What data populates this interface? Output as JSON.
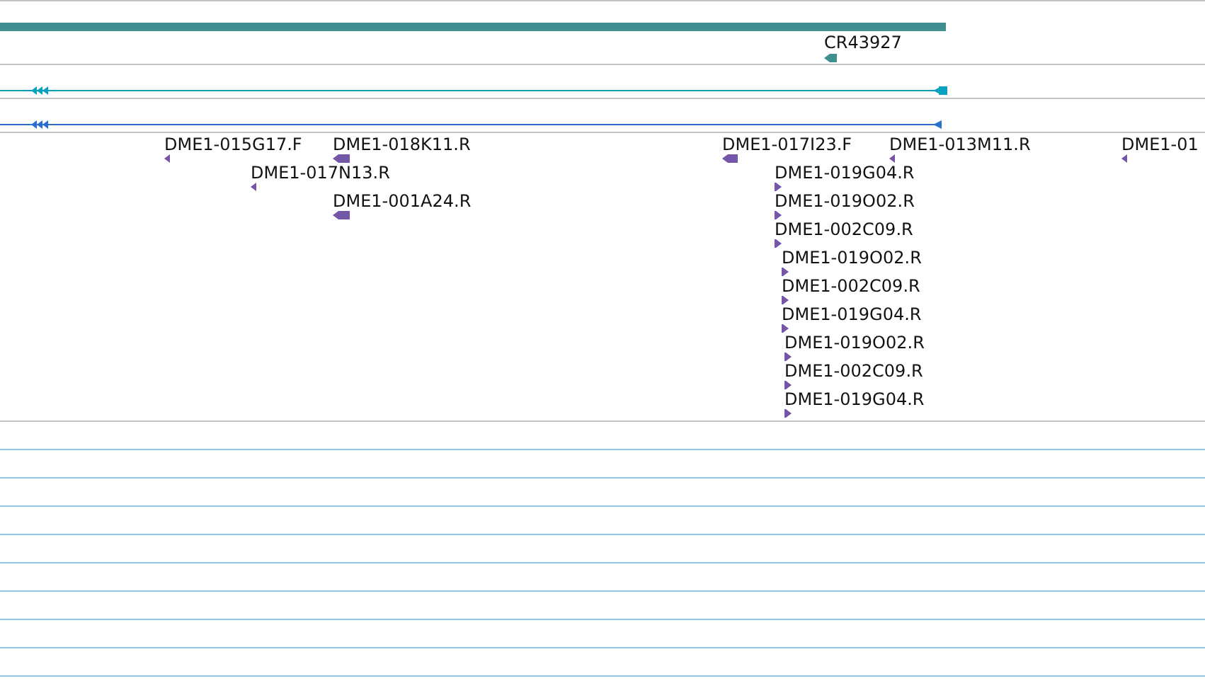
{
  "gene_track": {
    "gene": {
      "label": "CR43927",
      "reverse": true
    }
  },
  "transcript_tracks": [
    {
      "reverse": true,
      "color": "#0aa0c0"
    },
    {
      "reverse": true,
      "color": "#2a6fd0"
    }
  ],
  "feature_track": {
    "features": [
      {
        "label": "DME1-015G17.F",
        "reverse": true
      },
      {
        "label": "DME1-018K11.R",
        "reverse": true
      },
      {
        "label": "DME1-017N13.R",
        "reverse": true
      },
      {
        "label": "DME1-001A24.R",
        "reverse": true
      },
      {
        "label": "DME1-017I23.F",
        "reverse": true
      },
      {
        "label": "DME1-013M11.R",
        "reverse": true
      },
      {
        "label": "DME1-01",
        "reverse": true
      },
      {
        "label": "DME1-019G04.R",
        "reverse": false
      },
      {
        "label": "DME1-019O02.R",
        "reverse": false
      },
      {
        "label": "DME1-002C09.R",
        "reverse": false
      },
      {
        "label": "DME1-019O02.R",
        "reverse": false
      },
      {
        "label": "DME1-002C09.R",
        "reverse": false
      },
      {
        "label": "DME1-019G04.R",
        "reverse": false
      },
      {
        "label": "DME1-019O02.R",
        "reverse": false
      },
      {
        "label": "DME1-002C09.R",
        "reverse": false
      },
      {
        "label": "DME1-019G04.R",
        "reverse": false
      }
    ]
  }
}
